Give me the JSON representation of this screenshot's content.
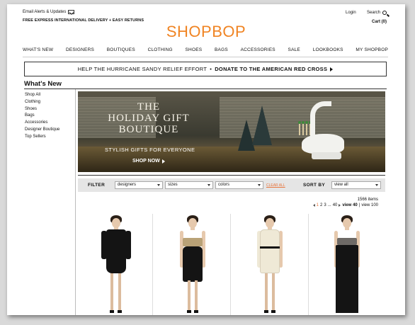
{
  "header": {
    "email_alerts": "Email Alerts & Updates",
    "shipping": "FREE EXPRESS INTERNATIONAL DELIVERY + EASY RETURNS",
    "login": "Login",
    "search": "Search",
    "cart": "Cart  (0)",
    "logo": "SHOPBOP",
    "brand_color": "#f08423"
  },
  "nav": [
    "WHAT'S NEW",
    "DESIGNERS",
    "BOUTIQUES",
    "CLOTHING",
    "SHOES",
    "BAGS",
    "ACCESSORIES",
    "SALE",
    "LOOKBOOKS",
    "MY SHOPBOP"
  ],
  "banner": {
    "text": "HELP THE HURRICANE SANDY RELIEF EFFORT",
    "sep": "•",
    "cta": "DONATE TO THE AMERICAN RED CROSS"
  },
  "section_title": "What's New",
  "sidebar": [
    "Shop All",
    "Clothing",
    "Shoes",
    "Bags",
    "Accessories",
    "Designer Boutique",
    "Top Sellers"
  ],
  "hero": {
    "title_line1": "THE",
    "title_line2": "HOLIDAY GIFT",
    "title_line3": "BOUTIQUE",
    "subtitle": "STYLISH GIFTS FOR EVERYONE",
    "cta": "SHOP NOW"
  },
  "filter": {
    "label": "FILTER",
    "designers": "designers",
    "sizes": "sizes",
    "colors": "colors",
    "clear": "CLEAR ALL",
    "sort_label": "SORT BY",
    "sort_value": "view all",
    "accent": "#e8743b"
  },
  "results": {
    "count": "1566 items",
    "pages": [
      "1",
      "2",
      "3",
      "...",
      "40"
    ],
    "view40": "view 40",
    "view100": "view 100",
    "divider": "|"
  },
  "products": [
    {
      "icon": "model-black-mini-dress"
    },
    {
      "icon": "model-gold-black-strapless-dress"
    },
    {
      "icon": "model-cream-one-shoulder-dress"
    },
    {
      "icon": "model-black-strapless-gown"
    }
  ]
}
